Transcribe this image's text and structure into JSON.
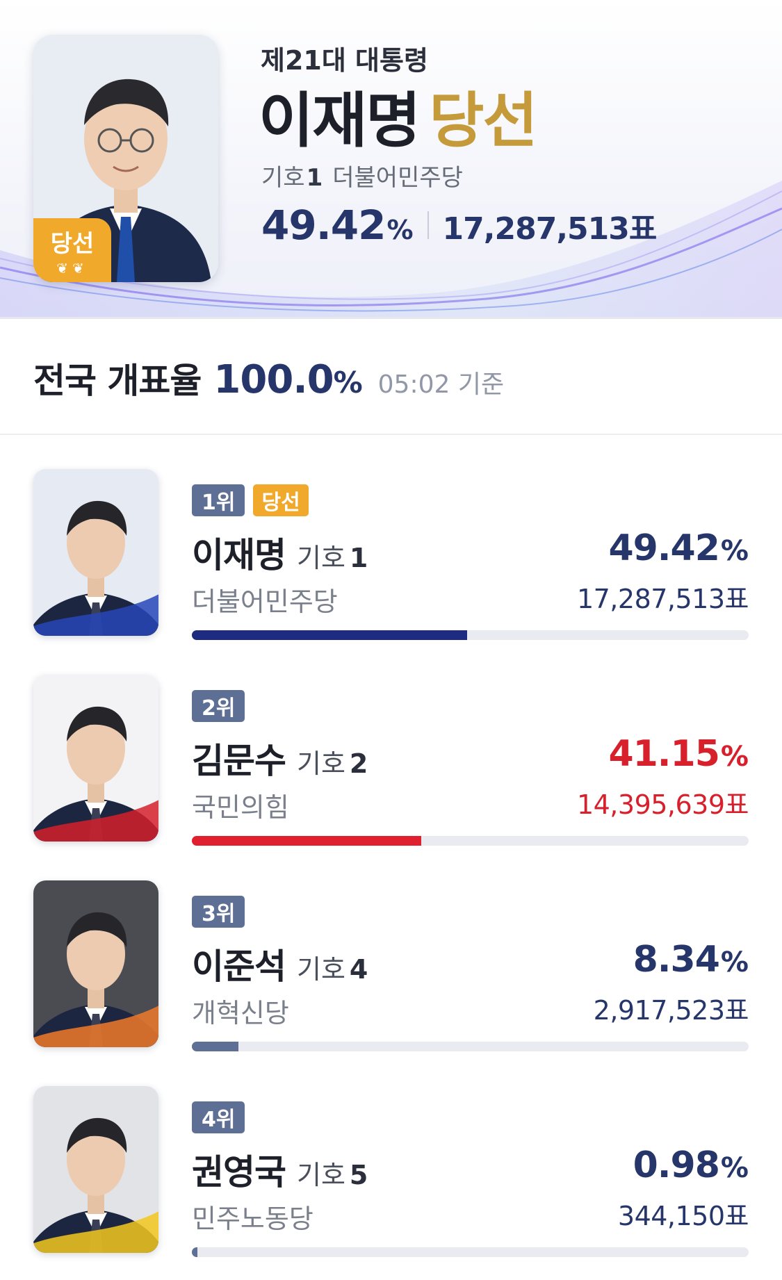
{
  "hero": {
    "election": "제21대 대통령",
    "name": "이재명",
    "elected": "당선",
    "ballot_label": "기호",
    "ballot_number": "1",
    "party": "더불어민주당",
    "percent": "49.42",
    "percent_sign": "%",
    "votes": "17,287,513표",
    "badge": "당선"
  },
  "count": {
    "label": "전국 개표율",
    "percent": "100.0",
    "percent_sign": "%",
    "time": "05:02 기준"
  },
  "candidates": [
    {
      "rank": "1위",
      "elected": "당선",
      "name": "이재명",
      "ballot_label": "기호",
      "ballot_number": "1",
      "party": "더불어민주당",
      "percent": "49.42",
      "percent_sign": "%",
      "votes": "17,287,513표",
      "share": 0.4942,
      "color": "#1e2b80",
      "text_color": "#26356a",
      "photo_accent": "#2747b8",
      "bg": "#e6eaf3"
    },
    {
      "rank": "2위",
      "elected": "",
      "name": "김문수",
      "ballot_label": "기호",
      "ballot_number": "2",
      "party": "국민의힘",
      "percent": "41.15",
      "percent_sign": "%",
      "votes": "14,395,639표",
      "share": 0.4115,
      "color": "#e0202e",
      "text_color": "#d8202c",
      "photo_accent": "#d3202c",
      "bg": "#f3f3f5"
    },
    {
      "rank": "3위",
      "elected": "",
      "name": "이준석",
      "ballot_label": "기호",
      "ballot_number": "4",
      "party": "개혁신당",
      "percent": "8.34",
      "percent_sign": "%",
      "votes": "2,917,523표",
      "share": 0.0834,
      "color": "#5e6f96",
      "text_color": "#26356a",
      "photo_accent": "#f07a2a",
      "bg": "#4a4c52"
    },
    {
      "rank": "4위",
      "elected": "",
      "name": "권영국",
      "ballot_label": "기호",
      "ballot_number": "5",
      "party": "민주노동당",
      "percent": "0.98",
      "percent_sign": "%",
      "votes": "344,150표",
      "share": 0.0098,
      "color": "#5e6f96",
      "text_color": "#26356a",
      "photo_accent": "#f2c81e",
      "bg": "#e2e3e7"
    }
  ]
}
